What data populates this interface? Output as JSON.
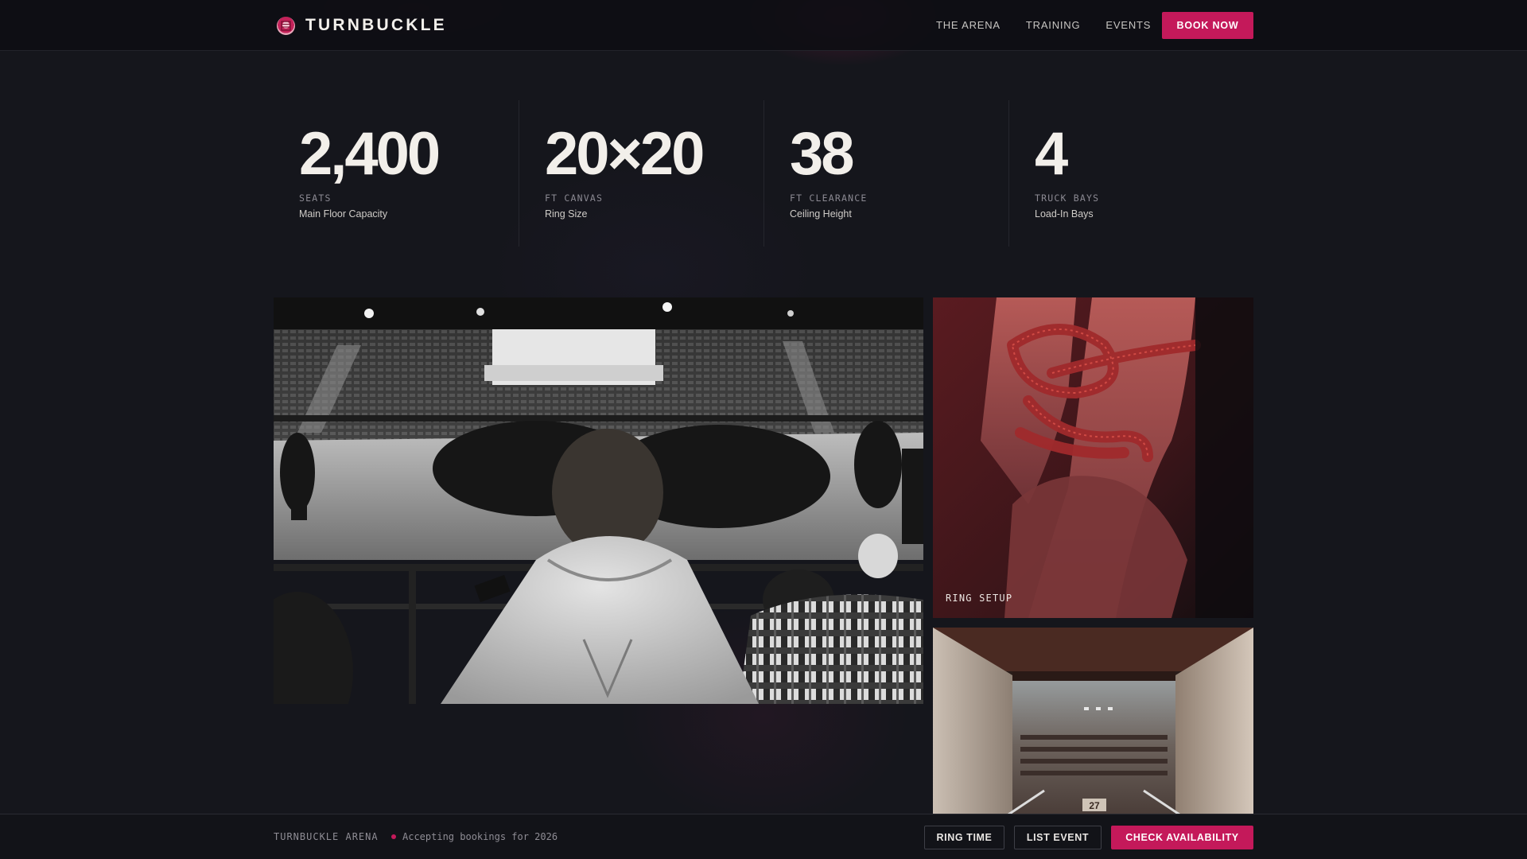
{
  "header": {
    "brand": "TURNBUCKLE",
    "logo_icon": "wrestling-ring-icon",
    "nav": [
      "THE ARENA",
      "TRAINING",
      "EVENTS"
    ],
    "cta": "BOOK NOW"
  },
  "stats": [
    {
      "value": "2,400",
      "unit": "SEATS",
      "desc": "Main Floor Capacity"
    },
    {
      "value": "20×20",
      "unit": "FT CANVAS",
      "desc": "Ring Size"
    },
    {
      "value": "38",
      "unit": "FT CLEARANCE",
      "desc": "Ceiling Height"
    },
    {
      "value": "4",
      "unit": "TRUCK BAYS",
      "desc": "Load-In Bays"
    }
  ],
  "gallery": {
    "rope_caption": "RING SETUP",
    "tunnel_sign": "27"
  },
  "footer": {
    "brand": "TURNBUCKLE ARENA",
    "status": "Accepting bookings for 2026",
    "buttons": [
      "RING TIME",
      "LIST EVENT",
      "CHECK AVAILABILITY"
    ]
  },
  "colors": {
    "accent": "#c4195a",
    "background": "#15161c",
    "text": "#e9e6e3"
  }
}
